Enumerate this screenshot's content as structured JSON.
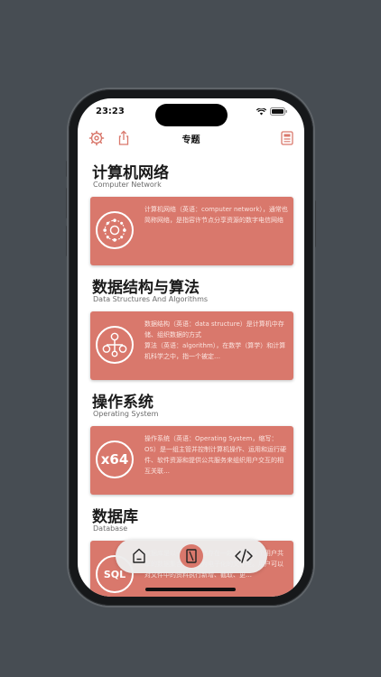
{
  "status": {
    "time": "23:23"
  },
  "nav": {
    "title": "专题"
  },
  "sections": [
    {
      "title": "计算机网络",
      "subtitle": "Computer Network",
      "description": "计算机网络（英语：computer network），通常也简称网络，是指容许节点分享资源的数字电信网络",
      "icon": "network-icon"
    },
    {
      "title": "数据结构与算法",
      "subtitle": "Data Structures And Algorithms",
      "description": "数据结构（英语：data structure）是计算机中存储、组织数据的方式\n算法（英语：algorithm），在数学（算学）和计算机科学之中，指一个被定…",
      "icon": "tree-icon"
    },
    {
      "title": "操作系统",
      "subtitle": "Operating System",
      "description": "操作系统（英语：Operating System，缩写：OS）是一组主管并控制计算机操作、运用和运行硬件、软件资源和提供公共服务来组织用户交互的相互关联…",
      "icon": "x64-icon",
      "icon_text": "x64"
    },
    {
      "title": "数据库",
      "subtitle": "Database",
      "description": "数据库是以一定方式储存在一起、能予多个用户共享的数据集合，可视为电子化的文件柜。用户可以对文件中的资料执行新增、截取、更…",
      "icon": "sql-icon",
      "icon_text": "SQL"
    }
  ],
  "tabs": [
    "home-icon",
    "book-icon",
    "code-icon"
  ],
  "colors": {
    "accent": "#d9786c",
    "card": "#d9786c",
    "background": "#474d53"
  }
}
